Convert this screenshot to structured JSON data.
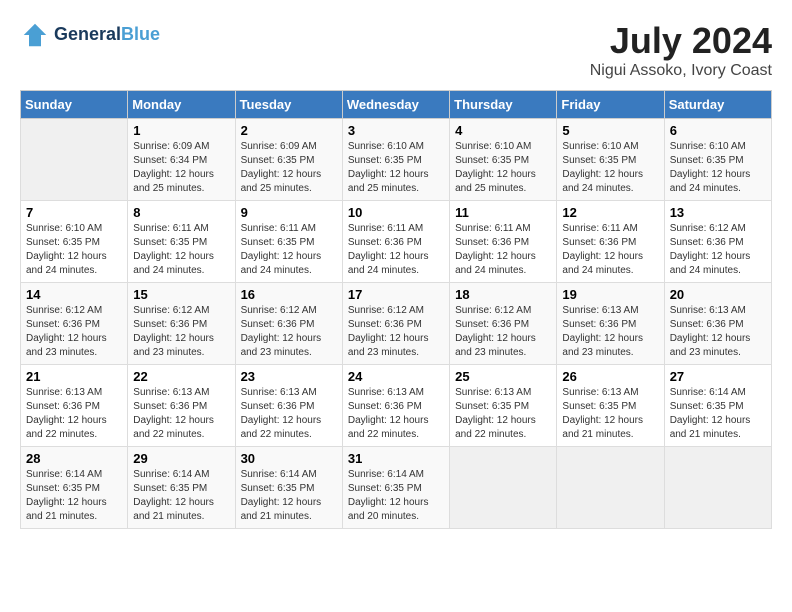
{
  "header": {
    "logo_line1": "General",
    "logo_line2": "Blue",
    "month_year": "July 2024",
    "location": "Nigui Assoko, Ivory Coast"
  },
  "days_of_week": [
    "Sunday",
    "Monday",
    "Tuesday",
    "Wednesday",
    "Thursday",
    "Friday",
    "Saturday"
  ],
  "weeks": [
    [
      {
        "day": "",
        "info": ""
      },
      {
        "day": "1",
        "info": "Sunrise: 6:09 AM\nSunset: 6:34 PM\nDaylight: 12 hours\nand 25 minutes."
      },
      {
        "day": "2",
        "info": "Sunrise: 6:09 AM\nSunset: 6:35 PM\nDaylight: 12 hours\nand 25 minutes."
      },
      {
        "day": "3",
        "info": "Sunrise: 6:10 AM\nSunset: 6:35 PM\nDaylight: 12 hours\nand 25 minutes."
      },
      {
        "day": "4",
        "info": "Sunrise: 6:10 AM\nSunset: 6:35 PM\nDaylight: 12 hours\nand 25 minutes."
      },
      {
        "day": "5",
        "info": "Sunrise: 6:10 AM\nSunset: 6:35 PM\nDaylight: 12 hours\nand 24 minutes."
      },
      {
        "day": "6",
        "info": "Sunrise: 6:10 AM\nSunset: 6:35 PM\nDaylight: 12 hours\nand 24 minutes."
      }
    ],
    [
      {
        "day": "7",
        "info": "Sunrise: 6:10 AM\nSunset: 6:35 PM\nDaylight: 12 hours\nand 24 minutes."
      },
      {
        "day": "8",
        "info": "Sunrise: 6:11 AM\nSunset: 6:35 PM\nDaylight: 12 hours\nand 24 minutes."
      },
      {
        "day": "9",
        "info": "Sunrise: 6:11 AM\nSunset: 6:35 PM\nDaylight: 12 hours\nand 24 minutes."
      },
      {
        "day": "10",
        "info": "Sunrise: 6:11 AM\nSunset: 6:36 PM\nDaylight: 12 hours\nand 24 minutes."
      },
      {
        "day": "11",
        "info": "Sunrise: 6:11 AM\nSunset: 6:36 PM\nDaylight: 12 hours\nand 24 minutes."
      },
      {
        "day": "12",
        "info": "Sunrise: 6:11 AM\nSunset: 6:36 PM\nDaylight: 12 hours\nand 24 minutes."
      },
      {
        "day": "13",
        "info": "Sunrise: 6:12 AM\nSunset: 6:36 PM\nDaylight: 12 hours\nand 24 minutes."
      }
    ],
    [
      {
        "day": "14",
        "info": "Sunrise: 6:12 AM\nSunset: 6:36 PM\nDaylight: 12 hours\nand 23 minutes."
      },
      {
        "day": "15",
        "info": "Sunrise: 6:12 AM\nSunset: 6:36 PM\nDaylight: 12 hours\nand 23 minutes."
      },
      {
        "day": "16",
        "info": "Sunrise: 6:12 AM\nSunset: 6:36 PM\nDaylight: 12 hours\nand 23 minutes."
      },
      {
        "day": "17",
        "info": "Sunrise: 6:12 AM\nSunset: 6:36 PM\nDaylight: 12 hours\nand 23 minutes."
      },
      {
        "day": "18",
        "info": "Sunrise: 6:12 AM\nSunset: 6:36 PM\nDaylight: 12 hours\nand 23 minutes."
      },
      {
        "day": "19",
        "info": "Sunrise: 6:13 AM\nSunset: 6:36 PM\nDaylight: 12 hours\nand 23 minutes."
      },
      {
        "day": "20",
        "info": "Sunrise: 6:13 AM\nSunset: 6:36 PM\nDaylight: 12 hours\nand 23 minutes."
      }
    ],
    [
      {
        "day": "21",
        "info": "Sunrise: 6:13 AM\nSunset: 6:36 PM\nDaylight: 12 hours\nand 22 minutes."
      },
      {
        "day": "22",
        "info": "Sunrise: 6:13 AM\nSunset: 6:36 PM\nDaylight: 12 hours\nand 22 minutes."
      },
      {
        "day": "23",
        "info": "Sunrise: 6:13 AM\nSunset: 6:36 PM\nDaylight: 12 hours\nand 22 minutes."
      },
      {
        "day": "24",
        "info": "Sunrise: 6:13 AM\nSunset: 6:36 PM\nDaylight: 12 hours\nand 22 minutes."
      },
      {
        "day": "25",
        "info": "Sunrise: 6:13 AM\nSunset: 6:35 PM\nDaylight: 12 hours\nand 22 minutes."
      },
      {
        "day": "26",
        "info": "Sunrise: 6:13 AM\nSunset: 6:35 PM\nDaylight: 12 hours\nand 21 minutes."
      },
      {
        "day": "27",
        "info": "Sunrise: 6:14 AM\nSunset: 6:35 PM\nDaylight: 12 hours\nand 21 minutes."
      }
    ],
    [
      {
        "day": "28",
        "info": "Sunrise: 6:14 AM\nSunset: 6:35 PM\nDaylight: 12 hours\nand 21 minutes."
      },
      {
        "day": "29",
        "info": "Sunrise: 6:14 AM\nSunset: 6:35 PM\nDaylight: 12 hours\nand 21 minutes."
      },
      {
        "day": "30",
        "info": "Sunrise: 6:14 AM\nSunset: 6:35 PM\nDaylight: 12 hours\nand 21 minutes."
      },
      {
        "day": "31",
        "info": "Sunrise: 6:14 AM\nSunset: 6:35 PM\nDaylight: 12 hours\nand 20 minutes."
      },
      {
        "day": "",
        "info": ""
      },
      {
        "day": "",
        "info": ""
      },
      {
        "day": "",
        "info": ""
      }
    ]
  ]
}
